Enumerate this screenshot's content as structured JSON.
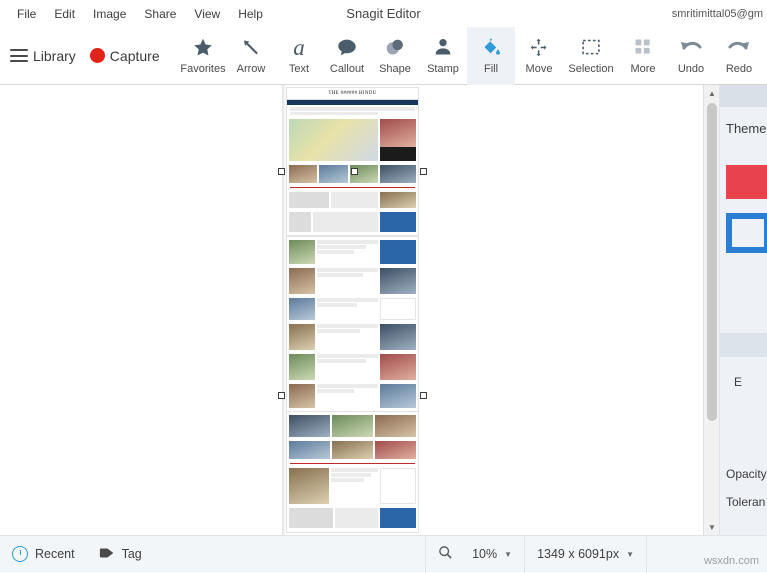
{
  "window": {
    "title": "Snagit Editor",
    "account": "smritimittal05@gm"
  },
  "menu": {
    "items": [
      {
        "label": "File"
      },
      {
        "label": "Edit"
      },
      {
        "label": "Image"
      },
      {
        "label": "Share"
      },
      {
        "label": "View"
      },
      {
        "label": "Help"
      }
    ]
  },
  "toolbar": {
    "library_label": "Library",
    "capture_label": "Capture",
    "tools": [
      {
        "label": "Favorites",
        "icon": "star-icon"
      },
      {
        "label": "Arrow",
        "icon": "arrow-icon"
      },
      {
        "label": "Text",
        "icon": "text-icon"
      },
      {
        "label": "Callout",
        "icon": "callout-icon"
      },
      {
        "label": "Shape",
        "icon": "shape-icon"
      },
      {
        "label": "Stamp",
        "icon": "stamp-icon"
      },
      {
        "label": "Fill",
        "icon": "fill-icon",
        "selected": true
      },
      {
        "label": "Move",
        "icon": "move-icon"
      },
      {
        "label": "Selection",
        "icon": "selection-icon"
      },
      {
        "label": "More",
        "icon": "more-icon"
      }
    ],
    "history": [
      {
        "label": "Undo",
        "icon": "undo-icon"
      },
      {
        "label": "Redo",
        "icon": "redo-icon"
      }
    ]
  },
  "canvas": {
    "page_masthead": "THE ###### HINDU"
  },
  "properties": {
    "title": "Theme",
    "color_red": "#e8434c",
    "color_blue": "#2a7fd4",
    "effects_label": "E",
    "opacity_label": "Opacity",
    "tolerance_label": "Toleran"
  },
  "statusbar": {
    "recent_label": "Recent",
    "tag_label": "Tag",
    "zoom_value": "10%",
    "dimensions": "1349 x 6091px",
    "watermark": "wsxdn.com"
  }
}
